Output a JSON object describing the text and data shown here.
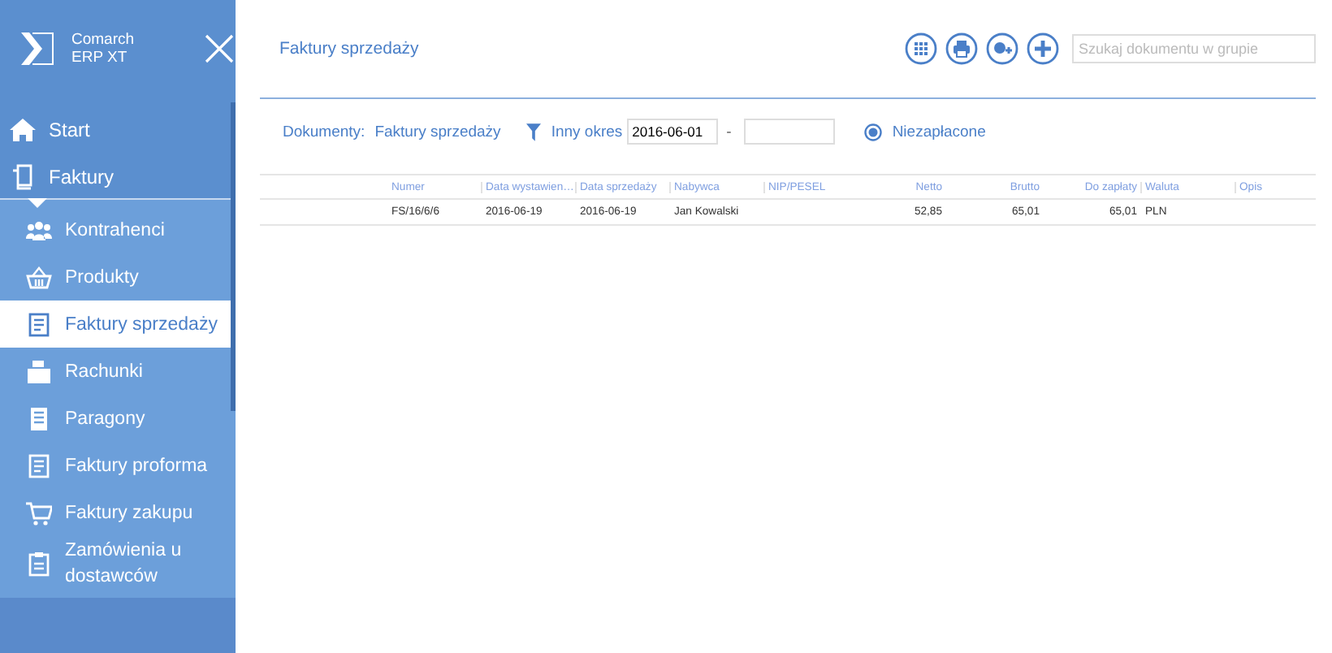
{
  "app": {
    "name": "Comarch ERP XT"
  },
  "menu": [
    {
      "label": "Start",
      "kind": "home"
    },
    {
      "label": "Faktury",
      "kind": "docs"
    }
  ],
  "submenu": [
    {
      "label": "Kontrahenci",
      "selected": false
    },
    {
      "label": "Produkty",
      "selected": false
    },
    {
      "label": "Faktury sprzedaży",
      "selected": true
    },
    {
      "label": "Rachunki",
      "selected": false
    },
    {
      "label": "Paragony",
      "selected": false
    },
    {
      "label": "Faktury proforma",
      "selected": false
    },
    {
      "label": "Faktury zakupu",
      "selected": false
    },
    {
      "label": "Zamówienia u dostawców",
      "selected": false
    }
  ],
  "header": {
    "title": "Faktury sprzedaży",
    "search_placeholder": "Szukaj dokumentu w grupie"
  },
  "filters": {
    "documents_label": "Dokumenty:",
    "documents_value": "Faktury sprzedaży",
    "period_label": "Inny okres",
    "date_from": "2016-06-01",
    "separator": "-",
    "unpaid_label": "Niezapłacone"
  },
  "table": {
    "columns": [
      {
        "label": "Numer",
        "kind": "text"
      },
      {
        "label": "Data wystawien…",
        "kind": "text"
      },
      {
        "label": "Data sprzedaży",
        "kind": "text"
      },
      {
        "label": "Nabywca",
        "kind": "text"
      },
      {
        "label": "NIP/PESEL",
        "kind": "text"
      },
      {
        "label": "Netto",
        "kind": "number"
      },
      {
        "label": "Brutto",
        "kind": "number"
      },
      {
        "label": "Do zapłaty",
        "kind": "number"
      },
      {
        "label": "Waluta",
        "kind": "text"
      },
      {
        "label": "Opis",
        "kind": "text"
      }
    ],
    "rows": [
      [
        "FS/16/6/6",
        "2016-06-19",
        "2016-06-19",
        "Jan Kowalski",
        "",
        "52,85",
        "65,01",
        "65,01",
        "PLN",
        ""
      ]
    ]
  }
}
